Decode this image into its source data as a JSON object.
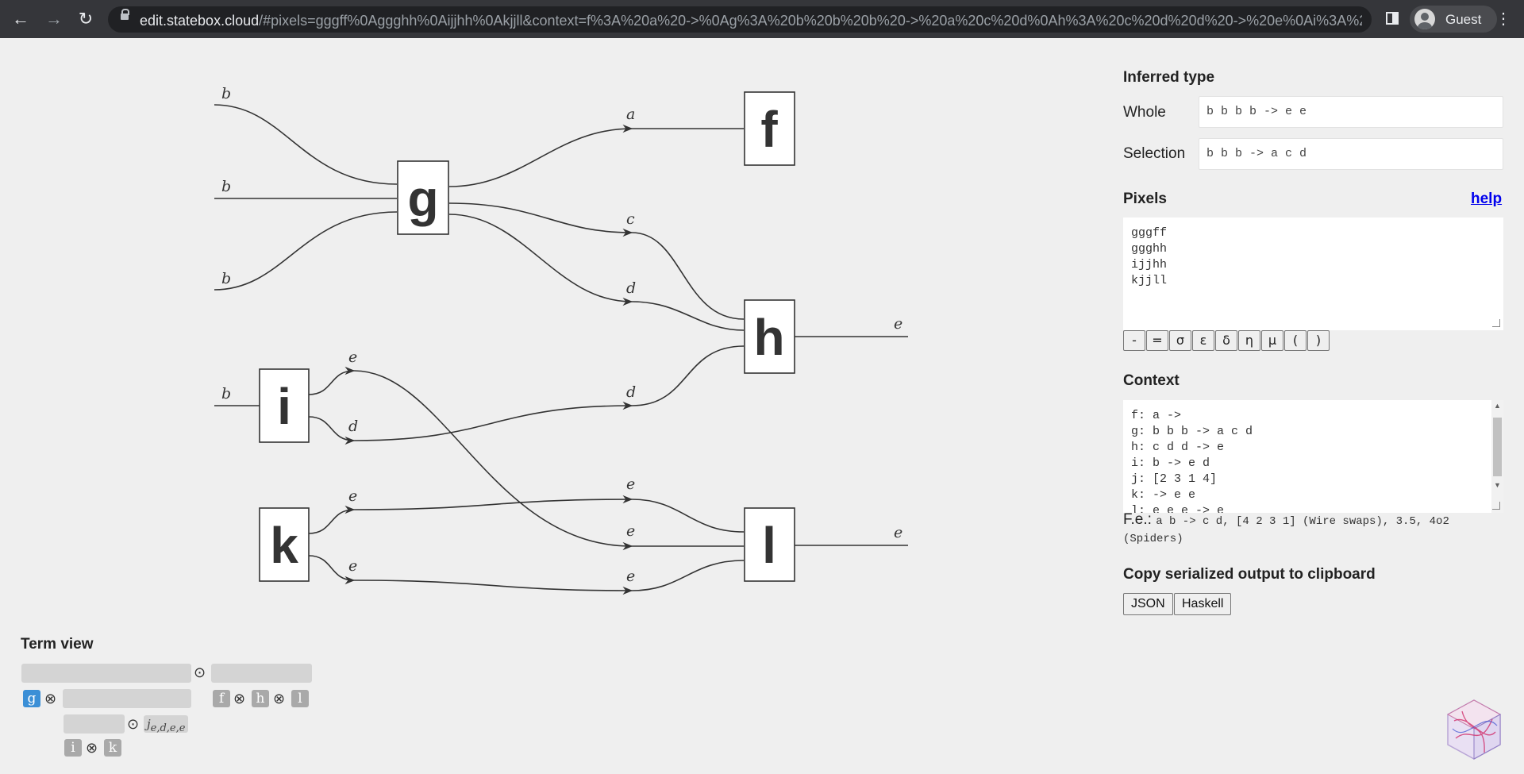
{
  "browser": {
    "url_host": "edit.statebox.cloud",
    "url_rest": "/#pixels=gggff%0Aggghh%0Aijjhh%0Akjjll&context=f%3A%20a%20->%0Ag%3A%20b%20b%20b%20->%20a%20c%20d%0Ah%3A%20c%20d%20d%20->%20e%0Ai%3A%20b%...",
    "profile_name": "Guest",
    "back_icon": "arrow-left-icon",
    "forward_icon": "arrow-right-icon",
    "reload_icon": "reload-icon"
  },
  "diagram": {
    "boxes": [
      "g",
      "f",
      "h",
      "i",
      "k",
      "l"
    ],
    "wire_labels": {
      "g_in_top": "b",
      "g_in_mid": "b",
      "g_in_bot": "b",
      "a": "a",
      "c": "c",
      "d1": "d",
      "d2": "d",
      "h_out": "e",
      "i_in": "b",
      "i_out_e": "e",
      "i_out_d": "d",
      "k_out_e1": "e",
      "k_out_e2": "e",
      "l_in1": "e",
      "l_in2": "e",
      "l_in3": "e",
      "l_out": "e"
    }
  },
  "term_view": {
    "title": "Term view",
    "tokens": {
      "g": "g",
      "f": "f",
      "h": "h",
      "l": "l",
      "i": "i",
      "k": "k"
    },
    "tensor": "⊗",
    "compose": "⊙",
    "j_label": "j",
    "j_sub": "e,d,e,e"
  },
  "panel": {
    "inferred_type": "Inferred type",
    "whole_label": "Whole",
    "whole_value": "b b b b -> e e",
    "selection_label": "Selection",
    "selection_value": "b b b -> a c d",
    "pixels_label": "Pixels",
    "help_label": "help",
    "pixels_value": "gggff\nggghh\nijjhh\nkjjll",
    "symbols": [
      "-",
      "=",
      "σ",
      "ε",
      "δ",
      "η",
      "μ",
      "(",
      ")"
    ],
    "context_label": "Context",
    "context_value": "f: a ->\ng: b b b -> a c d\nh: c d d -> e\ni: b -> e d\nj: [2 3 1 4]\nk: -> e e\nl: e e e -> e",
    "fe_label": "F.e.:",
    "fe_text": "a b -> c d, [4 2 3 1] (Wire swaps), 3.5, 4o2",
    "fe_text2": "(Spiders)",
    "copy_label": "Copy serialized output to clipboard",
    "json_button": "JSON",
    "haskell_button": "Haskell"
  }
}
